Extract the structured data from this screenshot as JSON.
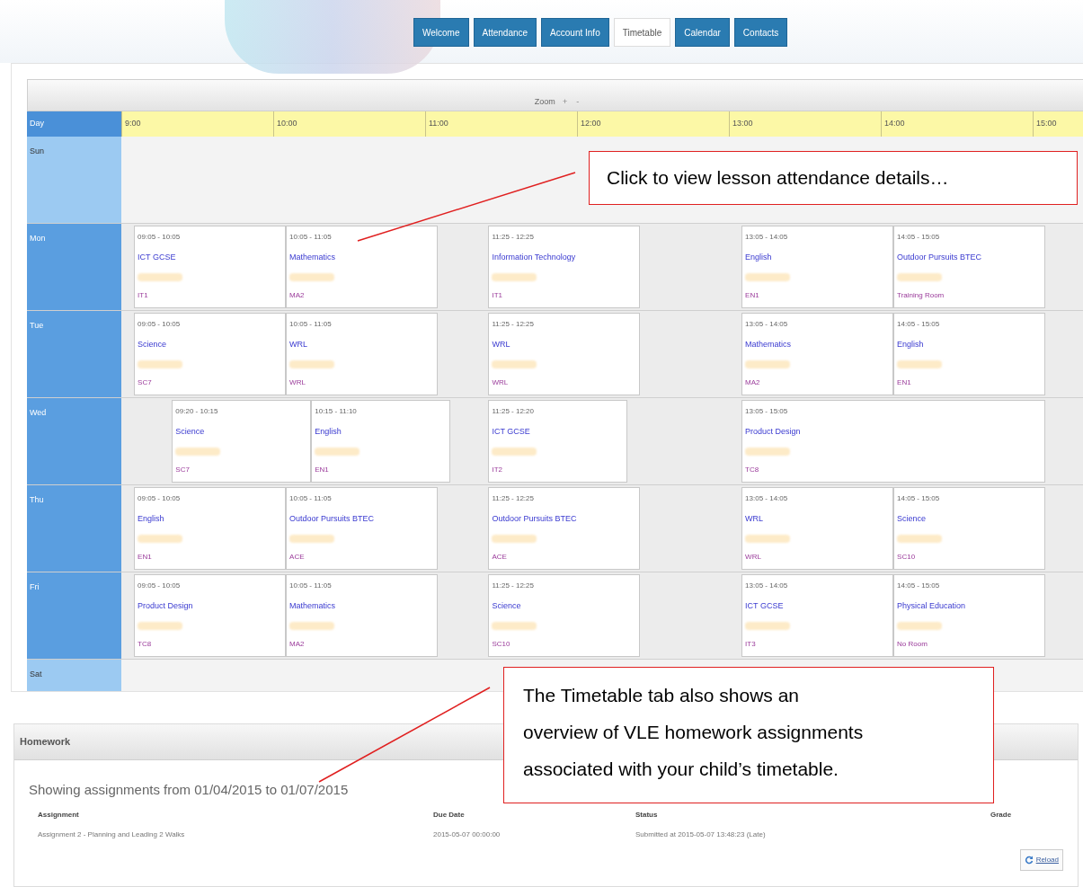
{
  "tabs": [
    {
      "label": "Welcome",
      "selected": false
    },
    {
      "label": "Attendance",
      "selected": false
    },
    {
      "label": "Account Info",
      "selected": false
    },
    {
      "label": "Timetable",
      "selected": true
    },
    {
      "label": "Calendar",
      "selected": false
    },
    {
      "label": "Contacts",
      "selected": false
    }
  ],
  "timetable": {
    "zoom_label": "Zoom",
    "zoom_controls": [
      "+",
      "-"
    ],
    "day_header": "Day",
    "hours": [
      "9:00",
      "10:00",
      "11:00",
      "12:00",
      "13:00",
      "14:00",
      "15:00"
    ],
    "days": [
      {
        "name": "Sun"
      },
      {
        "name": "Mon",
        "lessons": [
          {
            "time": "09:05 - 10:05",
            "subject": "ICT GCSE",
            "room": "IT1"
          },
          {
            "time": "10:05 - 11:05",
            "subject": "Mathematics",
            "room": "MA2"
          },
          {
            "time": "11:25 - 12:25",
            "subject": "Information Technology",
            "room": "IT1"
          },
          {
            "time": "13:05 - 14:05",
            "subject": "English",
            "room": "EN1"
          },
          {
            "time": "14:05 - 15:05",
            "subject": "Outdoor Pursuits BTEC",
            "room": "Training Room"
          }
        ]
      },
      {
        "name": "Tue",
        "lessons": [
          {
            "time": "09:05 - 10:05",
            "subject": "Science",
            "room": "SC7"
          },
          {
            "time": "10:05 - 11:05",
            "subject": "WRL",
            "room": "WRL"
          },
          {
            "time": "11:25 - 12:25",
            "subject": "WRL",
            "room": "WRL"
          },
          {
            "time": "13:05 - 14:05",
            "subject": "Mathematics",
            "room": "MA2"
          },
          {
            "time": "14:05 - 15:05",
            "subject": "English",
            "room": "EN1"
          }
        ]
      },
      {
        "name": "Wed",
        "lessons": [
          {
            "time": "09:20 - 10:15",
            "subject": "Science",
            "room": "SC7"
          },
          {
            "time": "10:15 - 11:10",
            "subject": "English",
            "room": "EN1"
          },
          {
            "time": "11:25 - 12:20",
            "subject": "ICT GCSE",
            "room": "IT2"
          },
          {
            "time": "13:05 - 15:05",
            "subject": "Product Design",
            "room": "TC8"
          }
        ]
      },
      {
        "name": "Thu",
        "lessons": [
          {
            "time": "09:05 - 10:05",
            "subject": "English",
            "room": "EN1"
          },
          {
            "time": "10:05 - 11:05",
            "subject": "Outdoor Pursuits BTEC",
            "room": "ACE"
          },
          {
            "time": "11:25 - 12:25",
            "subject": "Outdoor Pursuits BTEC",
            "room": "ACE"
          },
          {
            "time": "13:05 - 14:05",
            "subject": "WRL",
            "room": "WRL"
          },
          {
            "time": "14:05 - 15:05",
            "subject": "Science",
            "room": "SC10"
          }
        ]
      },
      {
        "name": "Fri",
        "lessons": [
          {
            "time": "09:05 - 10:05",
            "subject": "Product Design",
            "room": "TC8"
          },
          {
            "time": "10:05 - 11:05",
            "subject": "Mathematics",
            "room": "MA2"
          },
          {
            "time": "11:25 - 12:25",
            "subject": "Science",
            "room": "SC10"
          },
          {
            "time": "13:05 - 14:05",
            "subject": "ICT GCSE",
            "room": "IT3"
          },
          {
            "time": "14:05 - 15:05",
            "subject": "Physical Education",
            "room": "No Room"
          }
        ]
      },
      {
        "name": "Sat"
      }
    ]
  },
  "homework": {
    "title": "Homework",
    "range": "Showing assignments from 01/04/2015 to 01/07/2015",
    "columns": [
      "Assignment",
      "Due Date",
      "Status",
      "Grade"
    ],
    "rows": [
      [
        "Assignment 2 - Planning and Leading 2 Walks",
        "2015-05-07 00:00:00",
        "Submitted at 2015-05-07 13:48:23 (Late)"
      ]
    ],
    "reload": "Reload"
  },
  "callouts": [
    {
      "text": "Click to view lesson attendance details…"
    },
    {
      "text": "The Timetable tab also shows an overview of VLE homework assignments associated with your child’s timetable."
    }
  ]
}
